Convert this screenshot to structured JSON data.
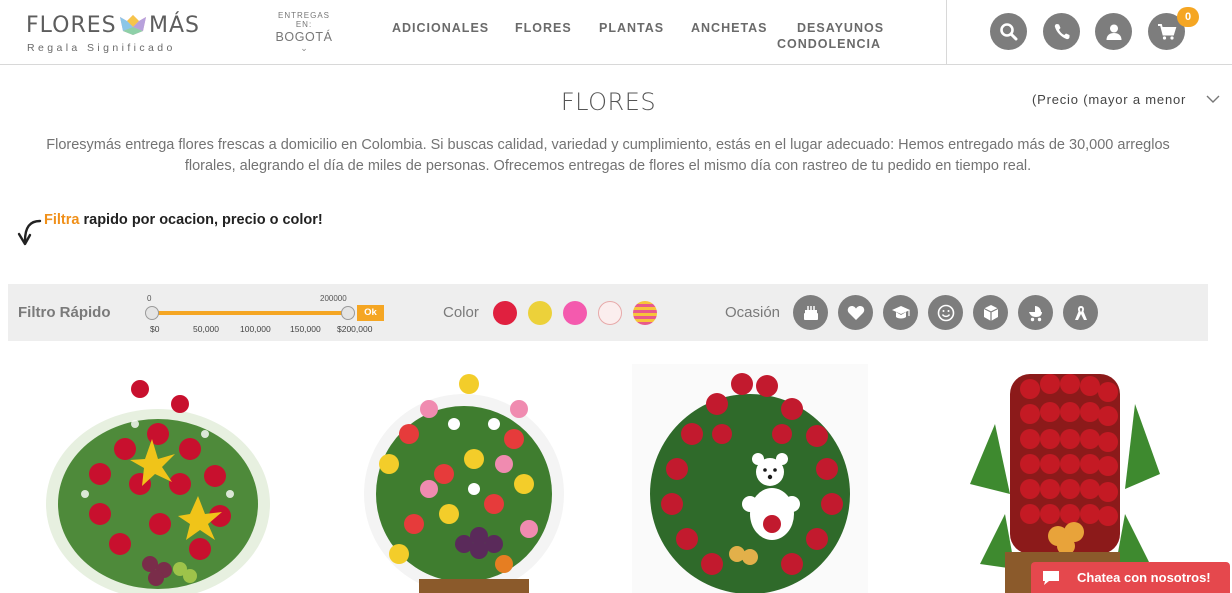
{
  "header": {
    "logo": {
      "left": "FLORES",
      "right": "MÁS",
      "tagline": "Regala Significado"
    },
    "delivery": {
      "label": "ENTREGAS EN:",
      "city": "BOGOTÁ"
    },
    "nav": [
      {
        "label": "ADICIONALES"
      },
      {
        "label": "FLORES"
      },
      {
        "label": "PLANTAS"
      },
      {
        "label": "ANCHETAS"
      },
      {
        "label": "DESAYUNOS"
      },
      {
        "label": "CONDOLENCIA"
      }
    ],
    "actions": {
      "icons": [
        "search-icon",
        "phone-icon",
        "user-icon",
        "cart-icon"
      ],
      "cart_count": "0"
    }
  },
  "page": {
    "title": "FLORES",
    "sort_label": "(Precio (mayor a menor",
    "intro": "Floresymás entrega flores frescas a domicilio en Colombia. Si buscas calidad, variedad y cumplimiento, estás en el lugar adecuado: Hemos entregado más de 30,000 arreglos florales, alegrando el día de miles de personas. Ofrecemos entregas de flores el mismo día con rastreo de tu pedido en tiempo real.",
    "filter_hint": {
      "highlight": "Filtra",
      "rest": " rapido por ocacion, precio o color!"
    }
  },
  "quick_filter": {
    "label": "Filtro Rápido",
    "price": {
      "current_min": "0",
      "current_max": "200000",
      "min_fraction": 0,
      "max_fraction": 1,
      "ticks": [
        "$0",
        "50,000",
        "100,000",
        "150,000",
        "$200,000"
      ],
      "ok_label": "Ok"
    },
    "color_label": "Color",
    "colors": [
      {
        "name": "rojo",
        "hex": "#e0203f"
      },
      {
        "name": "amarillo",
        "hex": "#ecd13a"
      },
      {
        "name": "rosado",
        "hex": "#f45aae"
      },
      {
        "name": "blanco",
        "hex": "#fbeeee"
      },
      {
        "name": "mixto",
        "hex": "#f0a05a"
      }
    ],
    "occasion_label": "Ocasión",
    "occasions": [
      "birthday-cake-icon",
      "heart-icon",
      "graduation-cap-icon",
      "smiley-icon",
      "gift-box-icon",
      "baby-stroller-icon",
      "ribbon-icon"
    ]
  },
  "products": [
    {
      "image": "flower-arrangement-lilies"
    },
    {
      "image": "flower-arrangement-mixed-fruit"
    },
    {
      "image": "flower-arrangement-teddy-bear"
    },
    {
      "image": "flower-arrangement-tall-roses"
    }
  ],
  "chat": {
    "label": "Chatea con nosotros!"
  },
  "theme": {
    "accent": "#f5a623",
    "icon_gray": "#7d7d7d",
    "chat_red": "#e5484d",
    "filter_bg": "#eeeeee"
  }
}
